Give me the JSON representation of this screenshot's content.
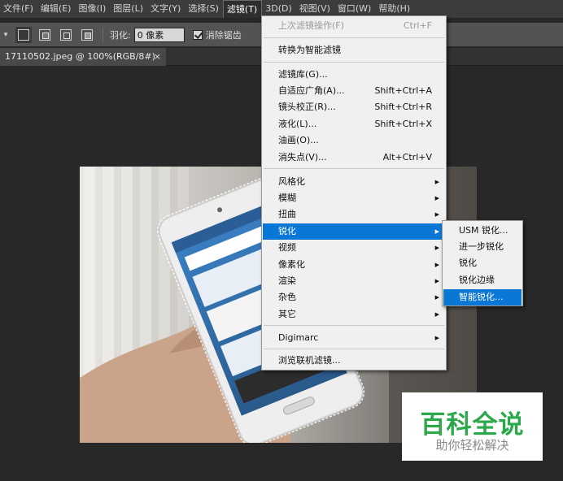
{
  "menubar": {
    "items": [
      {
        "label": "文件(F)"
      },
      {
        "label": "编辑(E)"
      },
      {
        "label": "图像(I)"
      },
      {
        "label": "图层(L)"
      },
      {
        "label": "文字(Y)"
      },
      {
        "label": "选择(S)"
      },
      {
        "label": "滤镜(T)"
      },
      {
        "label": "3D(D)"
      },
      {
        "label": "视图(V)"
      },
      {
        "label": "窗口(W)"
      },
      {
        "label": "帮助(H)"
      }
    ]
  },
  "options": {
    "feather_label": "羽化:",
    "feather_value": "0 像素",
    "antialias_label": "消除锯齿",
    "antialias_checked": true
  },
  "document_tab": {
    "title": "17110502.jpeg @ 100%(RGB/8#)",
    "close": "×"
  },
  "filter_menu": {
    "last_filter": {
      "label": "上次滤镜操作(F)",
      "shortcut": "Ctrl+F"
    },
    "convert_smart": "转换为智能滤镜",
    "gallery": [
      {
        "label": "滤镜库(G)...",
        "shortcut": ""
      },
      {
        "label": "自适应广角(A)...",
        "shortcut": "Shift+Ctrl+A"
      },
      {
        "label": "镜头校正(R)...",
        "shortcut": "Shift+Ctrl+R"
      },
      {
        "label": "液化(L)...",
        "shortcut": "Shift+Ctrl+X"
      },
      {
        "label": "油画(O)...",
        "shortcut": ""
      },
      {
        "label": "消失点(V)...",
        "shortcut": "Alt+Ctrl+V"
      }
    ],
    "categories": [
      {
        "label": "风格化",
        "arrow": "▶"
      },
      {
        "label": "模糊",
        "arrow": "▶"
      },
      {
        "label": "扭曲",
        "arrow": "▶"
      },
      {
        "label": "锐化",
        "arrow": "▶"
      },
      {
        "label": "视频",
        "arrow": "▶"
      },
      {
        "label": "像素化",
        "arrow": "▶"
      },
      {
        "label": "渲染",
        "arrow": "▶"
      },
      {
        "label": "杂色",
        "arrow": "▶"
      },
      {
        "label": "其它",
        "arrow": "▶"
      }
    ],
    "digimarc": {
      "label": "Digimarc",
      "arrow": "▶"
    },
    "browse_online": "浏览联机滤镜..."
  },
  "sharpen_submenu": {
    "items": [
      {
        "label": "USM 锐化..."
      },
      {
        "label": "进一步锐化"
      },
      {
        "label": "锐化"
      },
      {
        "label": "锐化边缘"
      },
      {
        "label": "智能锐化..."
      }
    ]
  },
  "watermark": {
    "title": "百科全说",
    "subtitle": "助你轻松解决"
  },
  "colors": {
    "menu_highlight": "#0a76d6",
    "watermark_green": "#2aa84a"
  }
}
